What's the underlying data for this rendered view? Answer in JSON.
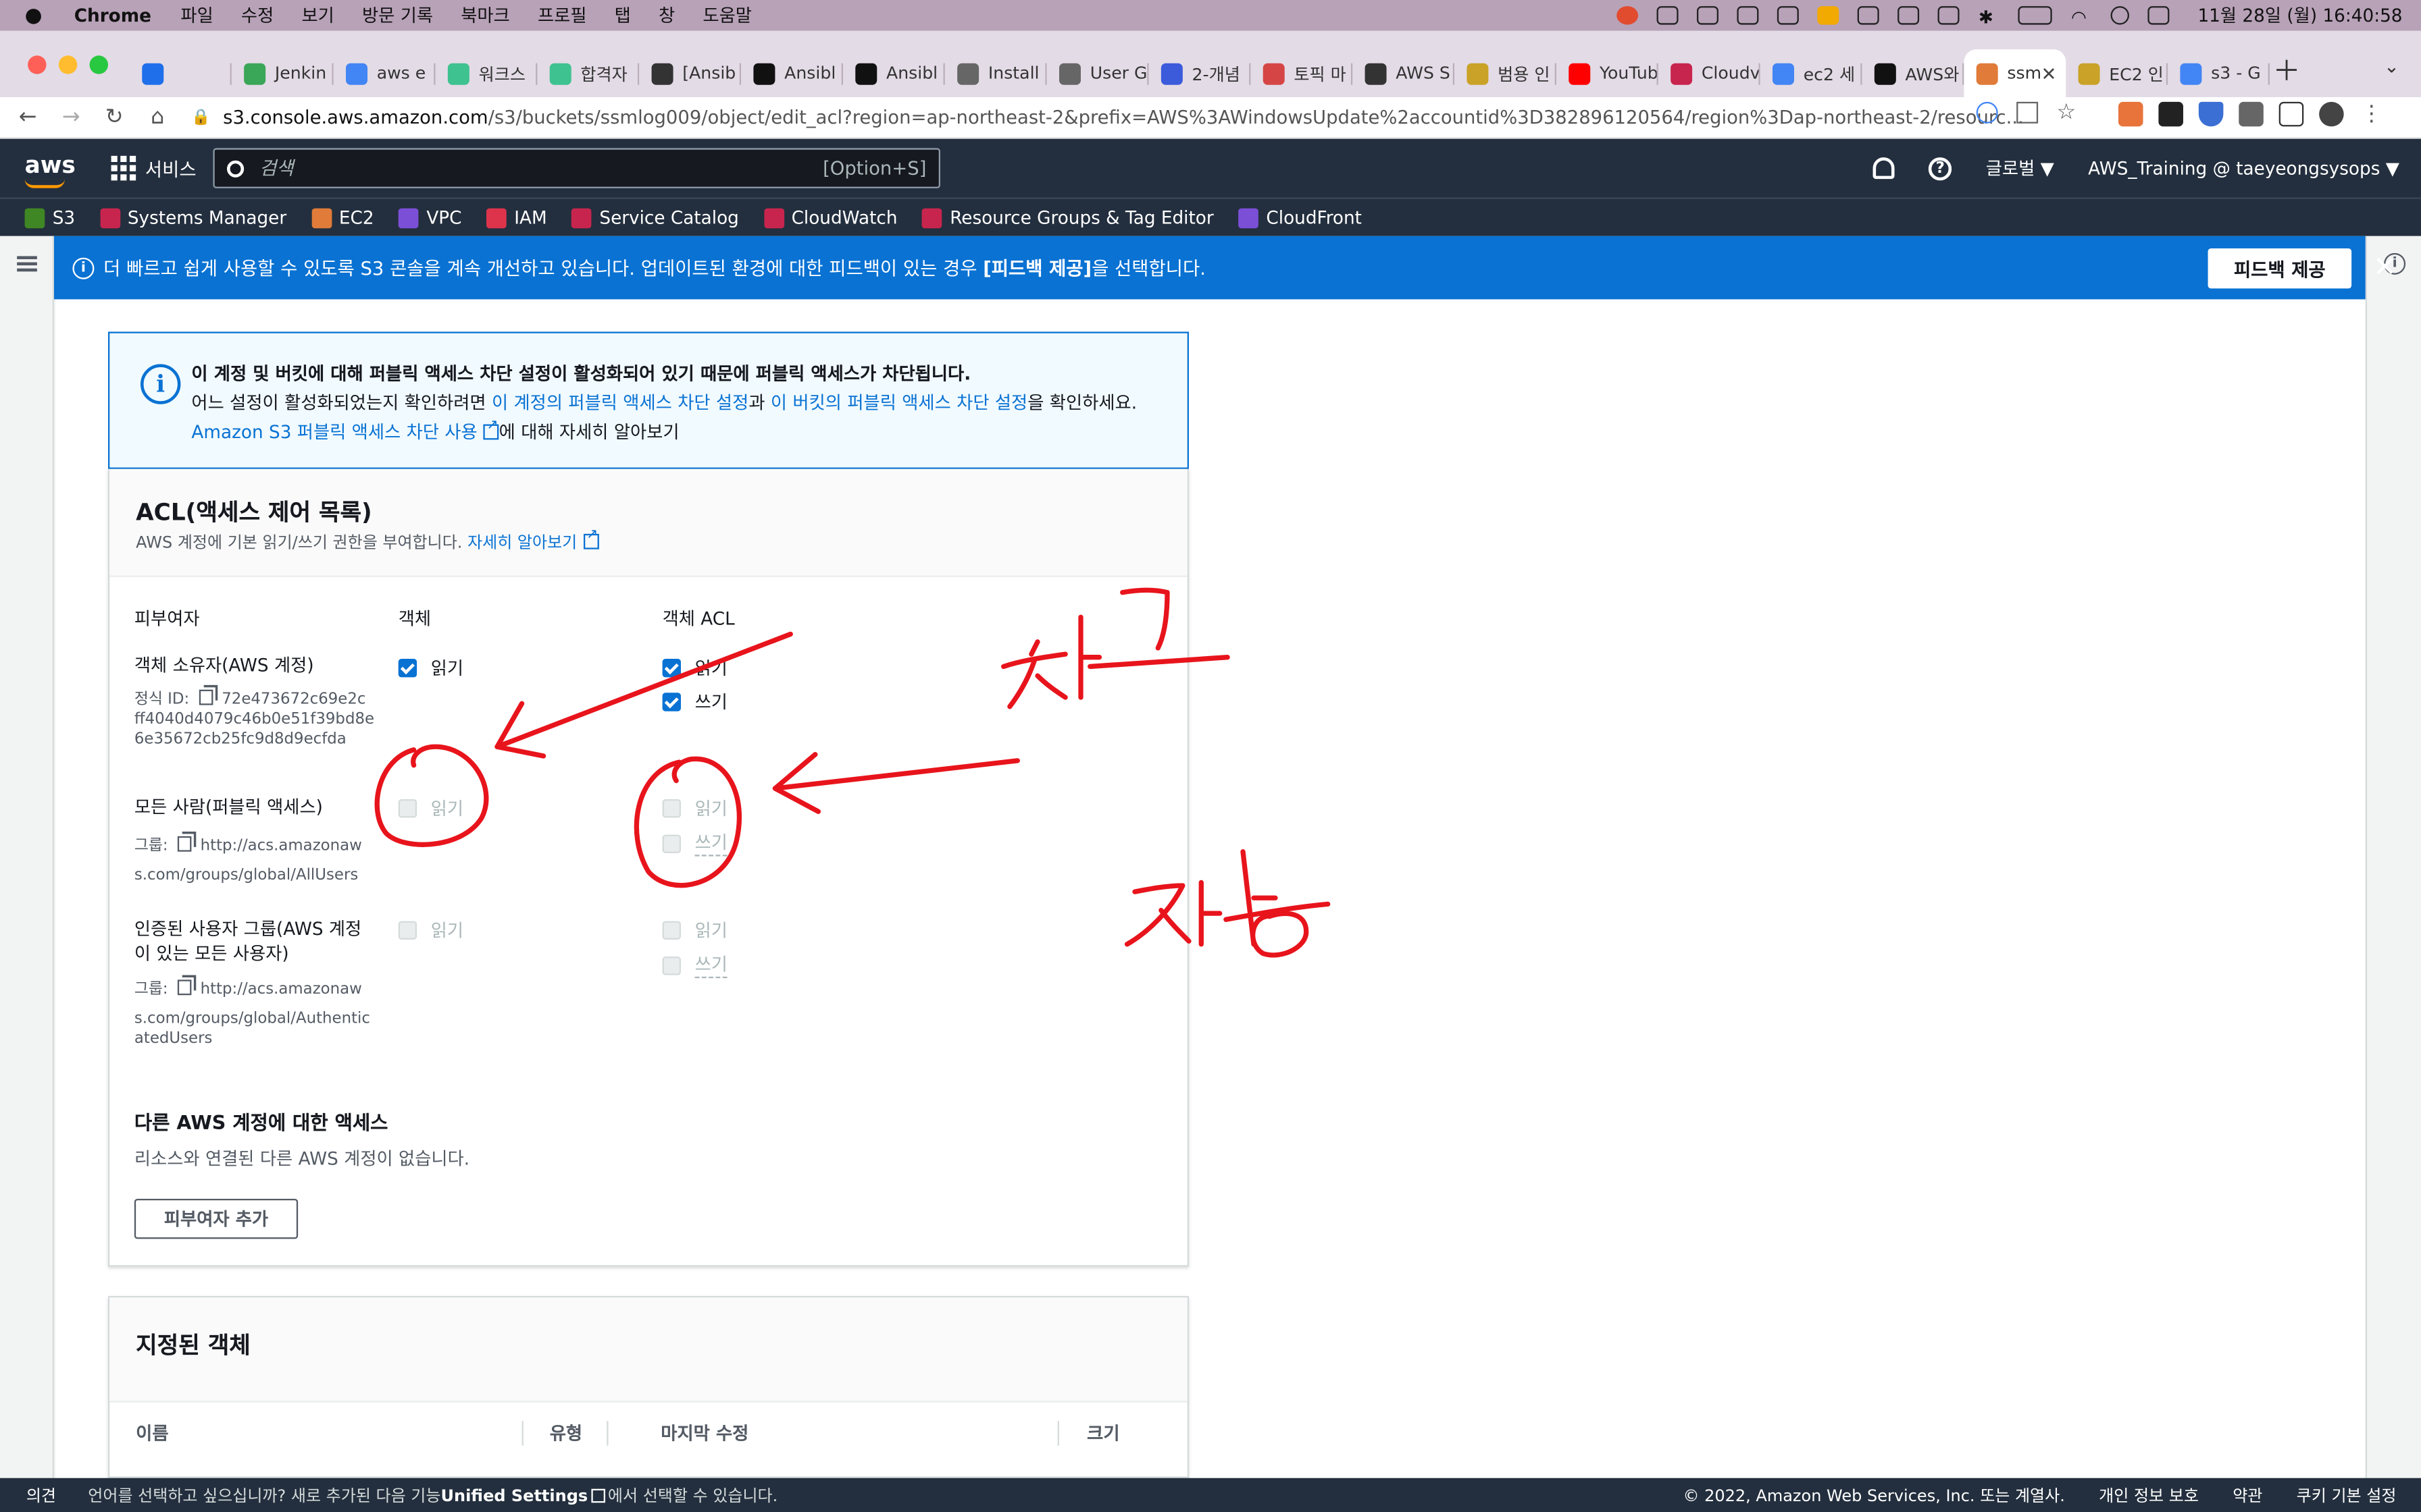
{
  "menubar": {
    "app": "Chrome",
    "items": [
      "파일",
      "수정",
      "보기",
      "방문 기록",
      "북마크",
      "프로필",
      "탭",
      "창",
      "도움말"
    ],
    "clock": "11월 28일 (월)  16:40:58"
  },
  "tabs": [
    {
      "label": "",
      "color": "#1f6feb"
    },
    {
      "label": "Jenkin",
      "color": "#3aa657"
    },
    {
      "label": "aws e",
      "color": "#4285f4"
    },
    {
      "label": "워크스",
      "color": "#3ec28f"
    },
    {
      "label": "합격자",
      "color": "#3ec28f"
    },
    {
      "label": "[Ansib",
      "color": "#333333"
    },
    {
      "label": "Ansibl",
      "color": "#111111"
    },
    {
      "label": "Ansibl",
      "color": "#111111"
    },
    {
      "label": "Install",
      "color": "#666666"
    },
    {
      "label": "User G",
      "color": "#666666"
    },
    {
      "label": "2-개념",
      "color": "#3b5bdb"
    },
    {
      "label": "토픽 마",
      "color": "#d64545"
    },
    {
      "label": "AWS S",
      "color": "#333333"
    },
    {
      "label": "범용 인",
      "color": "#c9a227"
    },
    {
      "label": "YouTub",
      "color": "#ff0000"
    },
    {
      "label": "Cloudv",
      "color": "#c7254e"
    },
    {
      "label": "ec2 세",
      "color": "#4285f4"
    },
    {
      "label": "AWS와",
      "color": "#111111"
    },
    {
      "label": "ssm",
      "color": "#e07b39",
      "active": true
    },
    {
      "label": "EC2 인",
      "color": "#c9a227"
    },
    {
      "label": "s3 - G",
      "color": "#4285f4"
    }
  ],
  "address": {
    "host": "s3.console.aws.amazon.com",
    "path": "/s3/buckets/ssmlog009/object/edit_acl?region=ap-northeast-2&prefix=AWS%3AWindowsUpdate%2accountid%3D382896120564/region%3Dap-northeast-2/resourc..."
  },
  "aws_header": {
    "logo": "aws",
    "services": "서비스",
    "search_placeholder": "검색",
    "search_hint": "[Option+S]",
    "region": "글로벌 ▼",
    "account": "AWS_Training @ taeyeongsysops ▼"
  },
  "favorites": [
    {
      "label": "S3",
      "color": "#3f8624"
    },
    {
      "label": "Systems Manager",
      "color": "#c7254e"
    },
    {
      "label": "EC2",
      "color": "#e07b39"
    },
    {
      "label": "VPC",
      "color": "#7b4fd6"
    },
    {
      "label": "IAM",
      "color": "#dd344c"
    },
    {
      "label": "Service Catalog",
      "color": "#c7254e"
    },
    {
      "label": "CloudWatch",
      "color": "#c7254e"
    },
    {
      "label": "Resource Groups & Tag Editor",
      "color": "#c7254e"
    },
    {
      "label": "CloudFront",
      "color": "#7b4fd6"
    }
  ],
  "flash": {
    "text_a": "더 빠르고 쉽게 사용할 수 있도록 S3 콘솔을 계속 개선하고 있습니다. 업데이트된 환경에 대한 피드백이 있는 경우 ",
    "bold": "[피드백 제공]",
    "text_b": "을 선택합니다.",
    "button": "피드백 제공"
  },
  "alert": {
    "title": "이 계정 및 버킷에 대해 퍼블릭 액세스 차단 설정이 활성화되어 있기 때문에 퍼블릭 액세스가 차단됩니다.",
    "line2_a": "어느 설정이 활성화되었는지 확인하려면 ",
    "link1": "이 계정의 퍼블릭 액세스 차단 설정",
    "line2_b": "과 ",
    "link2": "이 버킷의 퍼블릭 액세스 차단 설정",
    "line2_c": "을 확인하세요.",
    "link3": "Amazon S3 퍼블릭 액세스 차단 사용",
    "line3_b": "에 대해 자세히 알아보기"
  },
  "acl": {
    "title": "ACL(액세스 제어 목록)",
    "desc": "AWS 계정에 기본 읽기/쓰기 권한을 부여합니다. ",
    "learn_more": "자세히 알아보기",
    "col_grantee": "피부여자",
    "col_object": "객체",
    "col_object_acl": "객체 ACL",
    "read": "읽기",
    "write": "쓰기",
    "owner": {
      "name": "객체 소유자(AWS 계정)",
      "id_label": "정식 ID:",
      "id_lines": [
        "72e473672c69e2c",
        "ff4040d4079c46b0e51f39bd8e",
        "6e35672cb25fc9d8d9ecfda"
      ]
    },
    "everyone": {
      "name": "모든 사람(퍼블릭 액세스)",
      "group_label": "그룹:",
      "group_lines": [
        "http://acs.amazonaw",
        "s.com/groups/global/AllUsers"
      ]
    },
    "authenticated": {
      "name_lines": [
        "인증된 사용자 그룹(AWS 계정",
        "이 있는 모든 사용자)"
      ],
      "group_label": "그룹:",
      "group_lines": [
        "http://acs.amazonaw",
        "s.com/groups/global/Authentic",
        "atedUsers"
      ]
    },
    "other_title": "다른 AWS 계정에 대한 액세스",
    "other_desc": "리소스와 연결된 다른 AWS 계정이 없습니다.",
    "add_button": "피부여자 추가"
  },
  "specified": {
    "title": "지정된 객체",
    "columns": [
      "이름",
      "유형",
      "마지막 수정",
      "크기"
    ]
  },
  "footer": {
    "feedback": "의견",
    "lang_a": "언어를 선택하고 싶으십니까? 새로 추가된 다음 기능",
    "lang_bold": "Unified Settings",
    "lang_b": "에서 선택할 수 있습니다.",
    "copyright": "© 2022, Amazon Web Services, Inc. 또는 계열사.",
    "privacy": "개인 정보 보호",
    "terms": "약관",
    "cookies": "쿠키 기본 설정"
  },
  "colors": {
    "aws_dark": "#232f3e",
    "primary_blue": "#0972d3",
    "annotation_red": "#e8141c"
  }
}
